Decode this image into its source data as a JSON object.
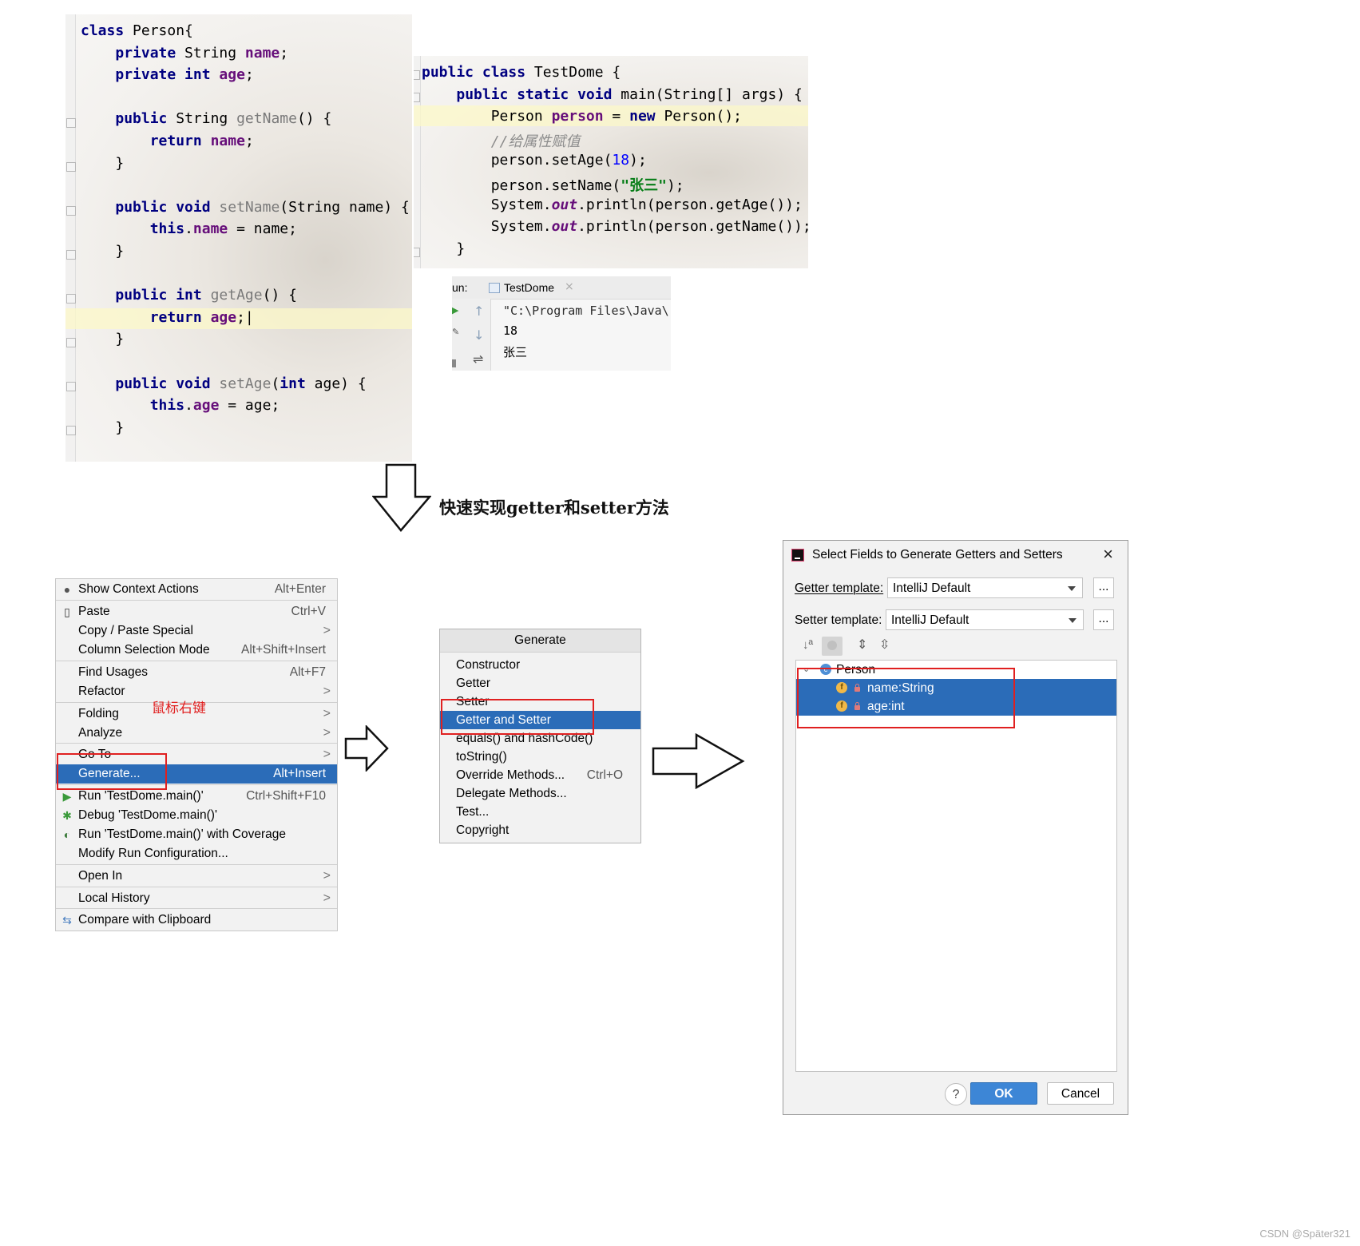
{
  "person_code": {
    "lines": [
      [
        [
          "kw",
          "class"
        ],
        [
          "t",
          " Person{"
        ]
      ],
      [
        [
          "t",
          "    "
        ],
        [
          "kw",
          "private"
        ],
        [
          "t",
          " String "
        ],
        [
          "fld",
          "name"
        ],
        [
          "t",
          ";"
        ]
      ],
      [
        [
          "t",
          "    "
        ],
        [
          "kw",
          "private int"
        ],
        [
          "t",
          " "
        ],
        [
          "fld",
          "age"
        ],
        [
          "t",
          ";"
        ]
      ],
      [],
      [
        [
          "t",
          "    "
        ],
        [
          "kw",
          "public"
        ],
        [
          "t",
          " String "
        ],
        [
          "mth",
          "getName"
        ],
        [
          "t",
          "() {"
        ]
      ],
      [
        [
          "t",
          "        "
        ],
        [
          "kw",
          "return"
        ],
        [
          "t",
          " "
        ],
        [
          "fld",
          "name"
        ],
        [
          "t",
          ";"
        ]
      ],
      [
        [
          "t",
          "    }"
        ]
      ],
      [],
      [
        [
          "t",
          "    "
        ],
        [
          "kw",
          "public void"
        ],
        [
          "t",
          " "
        ],
        [
          "mth",
          "setName"
        ],
        [
          "t",
          "(String name) {"
        ]
      ],
      [
        [
          "t",
          "        "
        ],
        [
          "kw",
          "this"
        ],
        [
          "t",
          "."
        ],
        [
          "fld",
          "name"
        ],
        [
          "t",
          " = name;"
        ]
      ],
      [
        [
          "t",
          "    }"
        ]
      ],
      [],
      [
        [
          "t",
          "    "
        ],
        [
          "kw",
          "public int"
        ],
        [
          "t",
          " "
        ],
        [
          "mth",
          "getAge"
        ],
        [
          "t",
          "() {"
        ]
      ],
      [
        [
          "t",
          "        "
        ],
        [
          "kw",
          "return"
        ],
        [
          "t",
          " "
        ],
        [
          "fld",
          "age"
        ],
        [
          "t",
          ";|"
        ]
      ],
      [
        [
          "t",
          "    }"
        ]
      ],
      [],
      [
        [
          "t",
          "    "
        ],
        [
          "kw",
          "public void"
        ],
        [
          "t",
          " "
        ],
        [
          "mth",
          "setAge"
        ],
        [
          "t",
          "("
        ],
        [
          "kw",
          "int"
        ],
        [
          "t",
          " age) {"
        ]
      ],
      [
        [
          "t",
          "        "
        ],
        [
          "kw",
          "this"
        ],
        [
          "t",
          "."
        ],
        [
          "fld",
          "age"
        ],
        [
          "t",
          " = age;"
        ]
      ],
      [
        [
          "t",
          "    }"
        ]
      ]
    ]
  },
  "test_code": {
    "lines": [
      [
        [
          "kw",
          "public class"
        ],
        [
          "t",
          " TestDome {"
        ]
      ],
      [
        [
          "t",
          "    "
        ],
        [
          "kw",
          "public static void"
        ],
        [
          "t",
          " main(String[] args) {"
        ]
      ],
      [
        [
          "t",
          "        Person "
        ],
        [
          "fld",
          "person"
        ],
        [
          "t",
          " = "
        ],
        [
          "kw",
          "new"
        ],
        [
          "t",
          " Person();"
        ]
      ],
      [
        [
          "t",
          "        "
        ],
        [
          "cmt",
          "//给属性赋值"
        ]
      ],
      [
        [
          "t",
          "        person.setAge("
        ],
        [
          "num",
          "18"
        ],
        [
          "t",
          ");"
        ]
      ],
      [
        [
          "t",
          "        person.setName("
        ],
        [
          "str",
          "\"张三\""
        ],
        [
          "t",
          ");"
        ]
      ],
      [
        [
          "t",
          "        System."
        ],
        [
          "stat",
          "out"
        ],
        [
          "t",
          ".println(person.getAge());"
        ]
      ],
      [
        [
          "t",
          "        System."
        ],
        [
          "stat",
          "out"
        ],
        [
          "t",
          ".println(person.getName());"
        ]
      ],
      [
        [
          "t",
          "    }"
        ]
      ]
    ]
  },
  "run_panel": {
    "label": "un:",
    "tab": "TestDome",
    "tab_close": "×",
    "output": [
      "\"C:\\Program Files\\Java\\",
      "18",
      "张三"
    ]
  },
  "arrow_caption": "快速实现getter和setter方法",
  "right_click_note": "鼠标右键",
  "context_menu": {
    "items": [
      {
        "label": "Show Context Actions",
        "shortcut": "Alt+Enter",
        "icon": "lightbulb-icon"
      },
      {
        "label": "Paste",
        "shortcut": "Ctrl+V",
        "icon": "clipboard-icon"
      },
      {
        "label": "Copy / Paste Special",
        "submenu": ">"
      },
      {
        "label": "Column Selection Mode",
        "shortcut": "Alt+Shift+Insert"
      },
      {
        "label": "Find Usages",
        "shortcut": "Alt+F7"
      },
      {
        "label": "Refactor",
        "submenu": ">"
      },
      {
        "label": "Folding",
        "submenu": ">"
      },
      {
        "label": "Analyze",
        "submenu": ">"
      },
      {
        "label": "Go To",
        "submenu": ">"
      },
      {
        "label": "Generate...",
        "shortcut": "Alt+Insert",
        "selected": true
      },
      {
        "label": "Run 'TestDome.main()'",
        "shortcut": "Ctrl+Shift+F10",
        "icon": "run-icon"
      },
      {
        "label": "Debug 'TestDome.main()'",
        "icon": "debug-icon"
      },
      {
        "label": "Run 'TestDome.main()' with Coverage",
        "icon": "coverage-icon"
      },
      {
        "label": "Modify Run Configuration..."
      },
      {
        "label": "Open In",
        "submenu": ">"
      },
      {
        "label": "Local History",
        "submenu": ">"
      },
      {
        "label": "Compare with Clipboard",
        "icon": "compare-icon"
      }
    ]
  },
  "generate_menu": {
    "title": "Generate",
    "items": [
      {
        "label": "Constructor"
      },
      {
        "label": "Getter"
      },
      {
        "label": "Setter"
      },
      {
        "label": "Getter and Setter",
        "selected": true
      },
      {
        "label": "equals() and hashCode()"
      },
      {
        "label": "toString()"
      },
      {
        "label": "Override Methods...",
        "shortcut": "Ctrl+O"
      },
      {
        "label": "Delegate Methods..."
      },
      {
        "label": "Test..."
      },
      {
        "label": "Copyright"
      }
    ]
  },
  "dialog": {
    "title": "Select Fields to Generate Getters and Setters",
    "close": "×",
    "getter_label": "Getter template:",
    "getter_value": "IntelliJ Default",
    "setter_label": "Setter template:",
    "setter_value": "IntelliJ Default",
    "dots": "...",
    "tree_root": "Person",
    "fields": [
      {
        "badge": "f",
        "label": "name:String"
      },
      {
        "badge": "f",
        "label": "age:int"
      }
    ],
    "help": "?",
    "ok": "OK",
    "cancel": "Cancel"
  },
  "watermark": "CSDN @Später321",
  "colors": {
    "selection": "#2b6cb8",
    "keyword": "#000080",
    "field": "#660e7a",
    "annotation_red": "#e02020"
  }
}
